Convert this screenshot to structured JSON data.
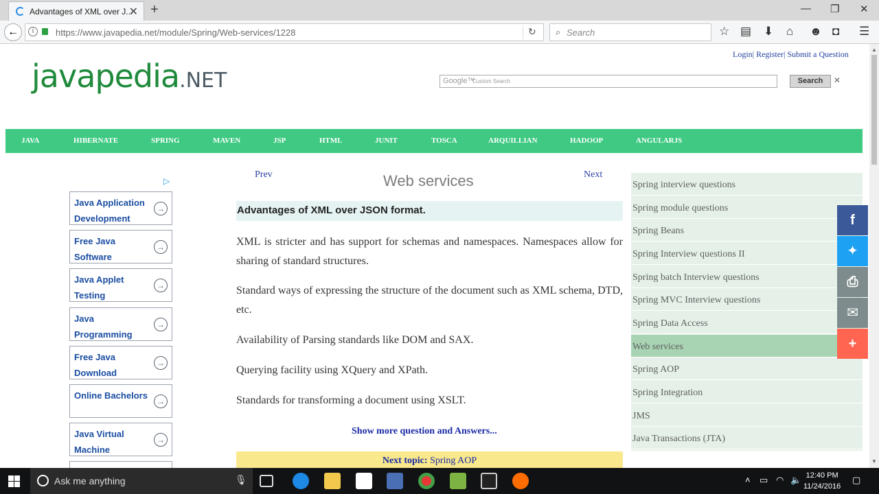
{
  "browser": {
    "tab_title": "Advantages of XML over J...",
    "url": "https://www.javapedia.net/module/Spring/Web-services/1228",
    "search_placeholder": "Search"
  },
  "site": {
    "logo_text": "javapedia",
    "logo_suffix": ".NET",
    "top_links": "Login| Register| Submit a Question",
    "google_label": "Google™",
    "google_hint": "Custom Search",
    "search_button": "Search"
  },
  "nav": {
    "items": [
      "JAVA",
      "HIBERNATE",
      "SPRING",
      "MAVEN",
      "JSP",
      "HTML",
      "JUNIT",
      "TOSCA",
      "ARQUILLIAN",
      "HADOOP",
      "ANGULARJS"
    ]
  },
  "ads": {
    "items": [
      {
        "label": "Java Application Development"
      },
      {
        "label": "Free Java Software"
      },
      {
        "label": "Java Applet Testing"
      },
      {
        "label": "Java Programming"
      },
      {
        "label": "Free Java Download"
      },
      {
        "label": "Online Bachelors"
      },
      {
        "label": "Java Virtual Machine"
      }
    ]
  },
  "content": {
    "prev": "Prev",
    "next": "Next",
    "title": "Web services",
    "question": "Advantages of XML over JSON format.",
    "paragraphs": [
      "XML is stricter and has support for schemas and namespaces. Namespaces allow for sharing of standard structures.",
      "Standard ways of expressing the structure of the document such as XML schema, DTD, etc.",
      "Availability of Parsing standards like DOM and SAX.",
      "Querying facility using XQuery and XPath.",
      "Standards for transforming a document using XSLT."
    ],
    "show_more": "Show more question and Answers...",
    "next_topic_label": "Next topic:",
    "next_topic_link": "Spring AOP"
  },
  "sidebar": {
    "items": [
      {
        "label": "Spring interview questions"
      },
      {
        "label": "Spring module questions"
      },
      {
        "label": "Spring Beans"
      },
      {
        "label": "Spring Interview questions II"
      },
      {
        "label": "Spring batch Interview questions"
      },
      {
        "label": "Spring MVC Interview questions"
      },
      {
        "label": "Spring Data Access"
      },
      {
        "label": "Web services"
      },
      {
        "label": "Spring AOP"
      },
      {
        "label": "Spring Integration"
      },
      {
        "label": "JMS"
      },
      {
        "label": "Java Transactions (JTA)"
      }
    ],
    "active": "Web services"
  },
  "share": {
    "buttons": [
      {
        "icon": "facebook-icon",
        "glyph": "f",
        "color": "#3b5998"
      },
      {
        "icon": "twitter-icon",
        "glyph": "✦",
        "color": "#1da1f2"
      },
      {
        "icon": "print-icon",
        "glyph": "⎙",
        "color": "#7f8c8d"
      },
      {
        "icon": "email-icon",
        "glyph": "✉",
        "color": "#7f8c8d"
      },
      {
        "icon": "plus-icon",
        "glyph": "+",
        "color": "#ff6550"
      }
    ]
  },
  "taskbar": {
    "search_placeholder": "Ask me anything",
    "time": "12:40 PM",
    "date": "11/24/2016"
  }
}
